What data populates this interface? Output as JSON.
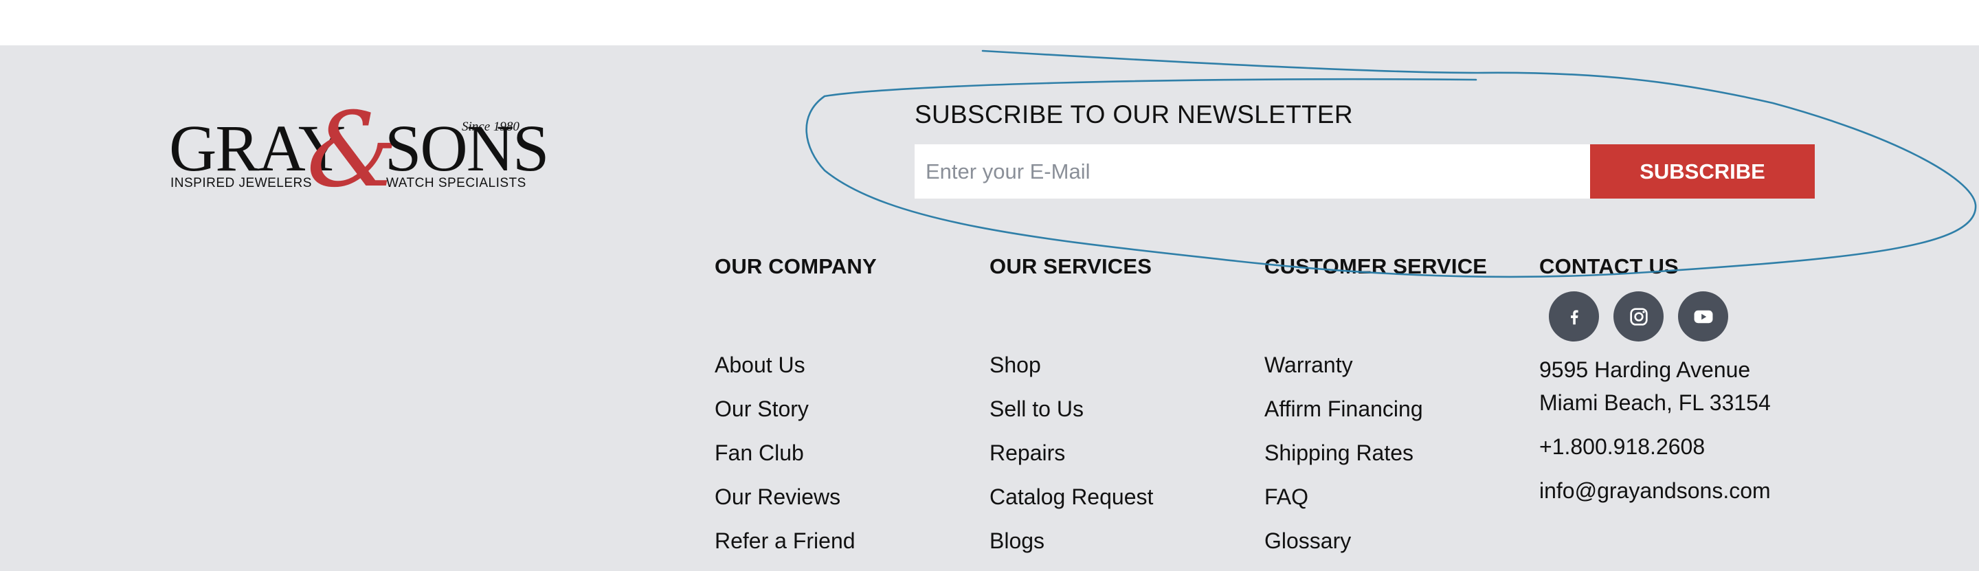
{
  "logo": {
    "word_left": "GRAY",
    "ampersand": "&",
    "word_right": "SONS",
    "since": "Since 1980",
    "tagline_left": "INSPIRED JEWELERS",
    "tagline_right": "WATCH SPECIALISTS"
  },
  "newsletter": {
    "title": "SUBSCRIBE TO OUR NEWSLETTER",
    "placeholder": "Enter your E-Mail",
    "button": "SUBSCRIBE"
  },
  "columns": [
    {
      "heading": "OUR COMPANY",
      "links": [
        "About Us",
        "Our Story",
        "Fan Club",
        "Our Reviews",
        "Refer a Friend"
      ]
    },
    {
      "heading": "OUR SERVICES",
      "links": [
        "Shop",
        "Sell to Us",
        "Repairs",
        "Catalog Request",
        "Blogs"
      ]
    },
    {
      "heading": "CUSTOMER SERVICE",
      "links": [
        "Warranty",
        "Affirm Financing",
        "Shipping Rates",
        "FAQ",
        "Glossary"
      ]
    }
  ],
  "contact": {
    "heading": "CONTACT US",
    "social_icons": [
      "facebook-icon",
      "instagram-icon",
      "youtube-icon"
    ],
    "address_line1": "9595 Harding Avenue",
    "address_line2": "Miami Beach, FL 33154",
    "phone": "+1.800.918.2608",
    "email": "info@grayandsons.com"
  },
  "colors": {
    "footer_bg": "#e4e5e8",
    "accent_red": "#c93934",
    "icon_bg": "#4a505b",
    "scribble": "#2f7fa8"
  }
}
